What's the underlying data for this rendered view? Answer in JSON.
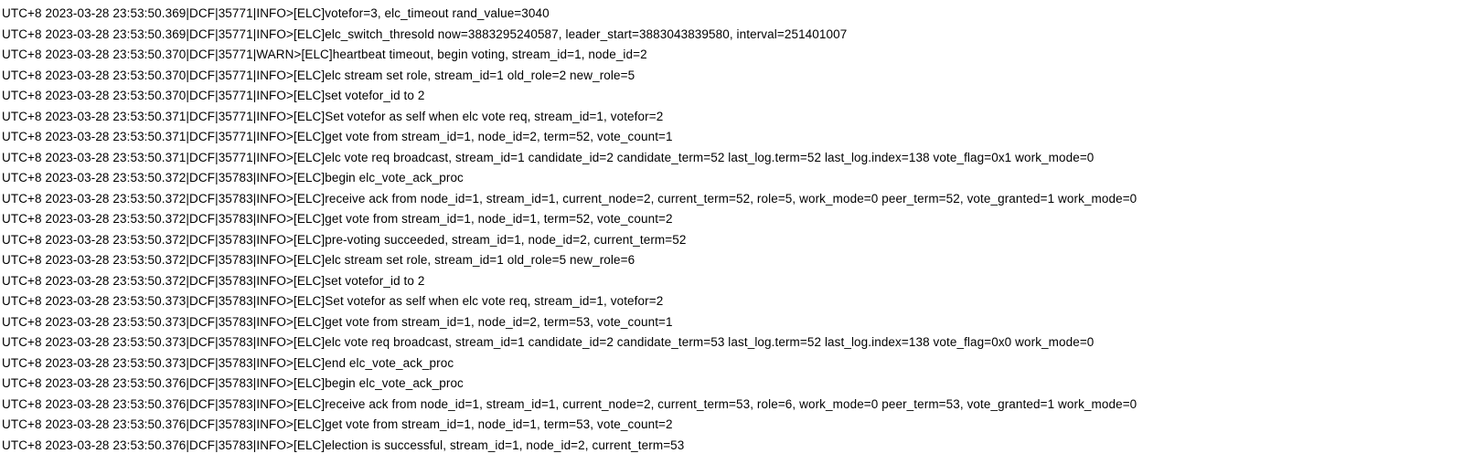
{
  "log": {
    "lines": [
      {
        "timestamp": "UTC+8 2023-03-28 23:53:50.369",
        "module": "DCF",
        "pid": "35771",
        "level": "INFO",
        "tag": "[ELC]",
        "message": "votefor=3, elc_timeout rand_value=3040"
      },
      {
        "timestamp": "UTC+8 2023-03-28 23:53:50.369",
        "module": "DCF",
        "pid": "35771",
        "level": "INFO",
        "tag": "[ELC]",
        "message": "elc_switch_thresold now=3883295240587, leader_start=3883043839580, interval=251401007"
      },
      {
        "timestamp": "UTC+8 2023-03-28 23:53:50.370",
        "module": "DCF",
        "pid": "35771",
        "level": "WARN",
        "tag": "[ELC]",
        "message": "heartbeat timeout, begin voting, stream_id=1, node_id=2"
      },
      {
        "timestamp": "UTC+8 2023-03-28 23:53:50.370",
        "module": "DCF",
        "pid": "35771",
        "level": "INFO",
        "tag": "[ELC]",
        "message": "elc stream set role, stream_id=1 old_role=2 new_role=5"
      },
      {
        "timestamp": "UTC+8 2023-03-28 23:53:50.370",
        "module": "DCF",
        "pid": "35771",
        "level": "INFO",
        "tag": "[ELC]",
        "message": "set votefor_id to 2"
      },
      {
        "timestamp": "UTC+8 2023-03-28 23:53:50.371",
        "module": "DCF",
        "pid": "35771",
        "level": "INFO",
        "tag": "[ELC]",
        "message": "Set votefor as self when elc vote req, stream_id=1, votefor=2"
      },
      {
        "timestamp": "UTC+8 2023-03-28 23:53:50.371",
        "module": "DCF",
        "pid": "35771",
        "level": "INFO",
        "tag": "[ELC]",
        "message": "get vote from stream_id=1, node_id=2, term=52, vote_count=1"
      },
      {
        "timestamp": "UTC+8 2023-03-28 23:53:50.371",
        "module": "DCF",
        "pid": "35771",
        "level": "INFO",
        "tag": "[ELC]",
        "message": "elc vote req broadcast, stream_id=1 candidate_id=2 candidate_term=52 last_log.term=52 last_log.index=138 vote_flag=0x1 work_mode=0"
      },
      {
        "timestamp": "UTC+8 2023-03-28 23:53:50.372",
        "module": "DCF",
        "pid": "35783",
        "level": "INFO",
        "tag": "[ELC]",
        "message": "begin elc_vote_ack_proc"
      },
      {
        "timestamp": "UTC+8 2023-03-28 23:53:50.372",
        "module": "DCF",
        "pid": "35783",
        "level": "INFO",
        "tag": "[ELC]",
        "message": "receive ack from node_id=1, stream_id=1, current_node=2, current_term=52, role=5, work_mode=0 peer_term=52, vote_granted=1 work_mode=0"
      },
      {
        "timestamp": "UTC+8 2023-03-28 23:53:50.372",
        "module": "DCF",
        "pid": "35783",
        "level": "INFO",
        "tag": "[ELC]",
        "message": "get vote from stream_id=1, node_id=1, term=52, vote_count=2"
      },
      {
        "timestamp": "UTC+8 2023-03-28 23:53:50.372",
        "module": "DCF",
        "pid": "35783",
        "level": "INFO",
        "tag": "[ELC]",
        "message": "pre-voting succeeded, stream_id=1, node_id=2, current_term=52"
      },
      {
        "timestamp": "UTC+8 2023-03-28 23:53:50.372",
        "module": "DCF",
        "pid": "35783",
        "level": "INFO",
        "tag": "[ELC]",
        "message": "elc stream set role, stream_id=1 old_role=5 new_role=6"
      },
      {
        "timestamp": "UTC+8 2023-03-28 23:53:50.372",
        "module": "DCF",
        "pid": "35783",
        "level": "INFO",
        "tag": "[ELC]",
        "message": "set votefor_id to 2"
      },
      {
        "timestamp": "UTC+8 2023-03-28 23:53:50.373",
        "module": "DCF",
        "pid": "35783",
        "level": "INFO",
        "tag": "[ELC]",
        "message": "Set votefor as self when elc vote req, stream_id=1, votefor=2"
      },
      {
        "timestamp": "UTC+8 2023-03-28 23:53:50.373",
        "module": "DCF",
        "pid": "35783",
        "level": "INFO",
        "tag": "[ELC]",
        "message": "get vote from stream_id=1, node_id=2, term=53, vote_count=1"
      },
      {
        "timestamp": "UTC+8 2023-03-28 23:53:50.373",
        "module": "DCF",
        "pid": "35783",
        "level": "INFO",
        "tag": "[ELC]",
        "message": "elc vote req broadcast, stream_id=1 candidate_id=2 candidate_term=53 last_log.term=52 last_log.index=138 vote_flag=0x0 work_mode=0"
      },
      {
        "timestamp": "UTC+8 2023-03-28 23:53:50.373",
        "module": "DCF",
        "pid": "35783",
        "level": "INFO",
        "tag": "[ELC]",
        "message": "end elc_vote_ack_proc"
      },
      {
        "timestamp": "UTC+8 2023-03-28 23:53:50.376",
        "module": "DCF",
        "pid": "35783",
        "level": "INFO",
        "tag": "[ELC]",
        "message": "begin elc_vote_ack_proc"
      },
      {
        "timestamp": "UTC+8 2023-03-28 23:53:50.376",
        "module": "DCF",
        "pid": "35783",
        "level": "INFO",
        "tag": "[ELC]",
        "message": "receive ack from node_id=1, stream_id=1, current_node=2, current_term=53, role=6, work_mode=0 peer_term=53, vote_granted=1 work_mode=0"
      },
      {
        "timestamp": "UTC+8 2023-03-28 23:53:50.376",
        "module": "DCF",
        "pid": "35783",
        "level": "INFO",
        "tag": "[ELC]",
        "message": "get vote from stream_id=1, node_id=1, term=53, vote_count=2"
      },
      {
        "timestamp": "UTC+8 2023-03-28 23:53:50.376",
        "module": "DCF",
        "pid": "35783",
        "level": "INFO",
        "tag": "[ELC]",
        "message": "election is successful, stream_id=1, node_id=2, current_term=53"
      }
    ]
  }
}
